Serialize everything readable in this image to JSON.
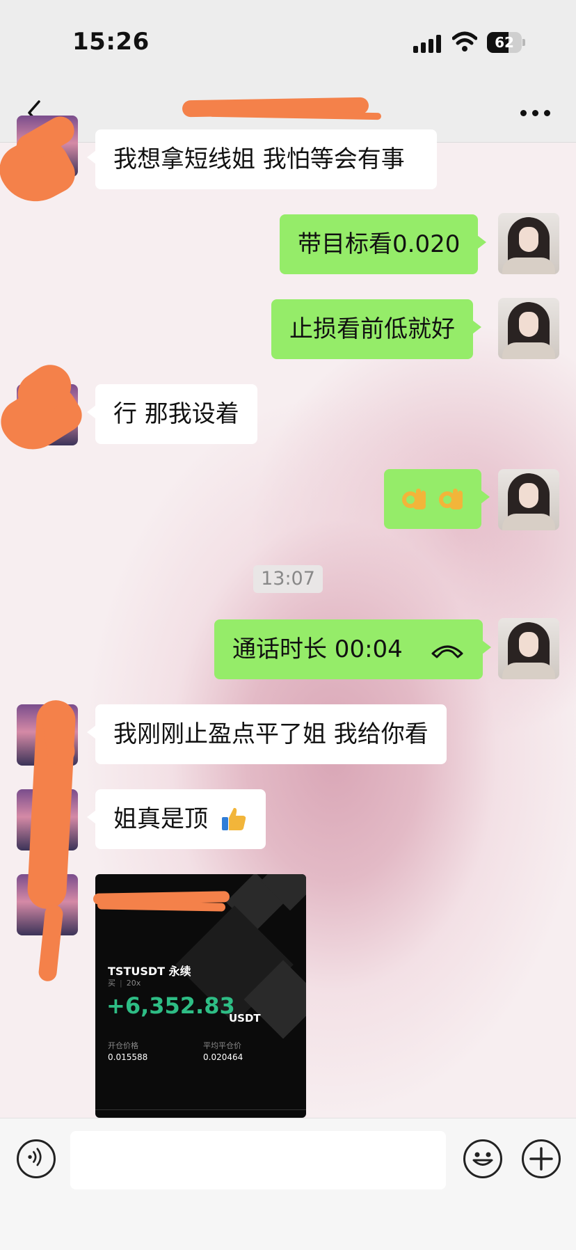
{
  "status_bar": {
    "time": "15:26",
    "battery": "62",
    "battery_level": 0.62
  },
  "nav": {
    "title": "",
    "back_icon": "chevron-left-icon",
    "more_icon": "more-dots-icon"
  },
  "messages": [
    {
      "side": "in",
      "text": "我想拿短线姐 我怕等会有事"
    },
    {
      "side": "out",
      "text": "带目标看0.020"
    },
    {
      "side": "out",
      "text": "止损看前低就好"
    },
    {
      "side": "in",
      "text": "行 那我设着"
    },
    {
      "side": "out",
      "emoji": [
        "ok-hand-emoji",
        "ok-hand-emoji"
      ]
    },
    {
      "side": "out",
      "text": "通话时长 00:04",
      "icon": "hangup-phone-icon"
    },
    {
      "side": "in",
      "text": "我刚刚止盈点平了姐 我给你看"
    },
    {
      "side": "in",
      "text": "姐真是顶",
      "icon": "thumbs-up-emoji"
    }
  ],
  "timestamp": "13:07",
  "trade_card": {
    "pair": "TSTUSDT 永续",
    "side": "买",
    "leverage": "20x",
    "pnl": "+6,352.83",
    "unit": "USDT",
    "open_label": "开仓价格",
    "open_value": "0.015588",
    "close_label": "平均平仓价",
    "close_value": "0.020464"
  },
  "input_bar": {
    "voice_icon": "voice-icon",
    "emoji_icon": "smiley-icon",
    "plus_icon": "plus-icon",
    "placeholder": ""
  },
  "colors": {
    "outgoing_bubble": "#95ec69",
    "incoming_bubble": "#ffffff",
    "pnl_green": "#2ebd85",
    "redaction": "#f4814a"
  }
}
